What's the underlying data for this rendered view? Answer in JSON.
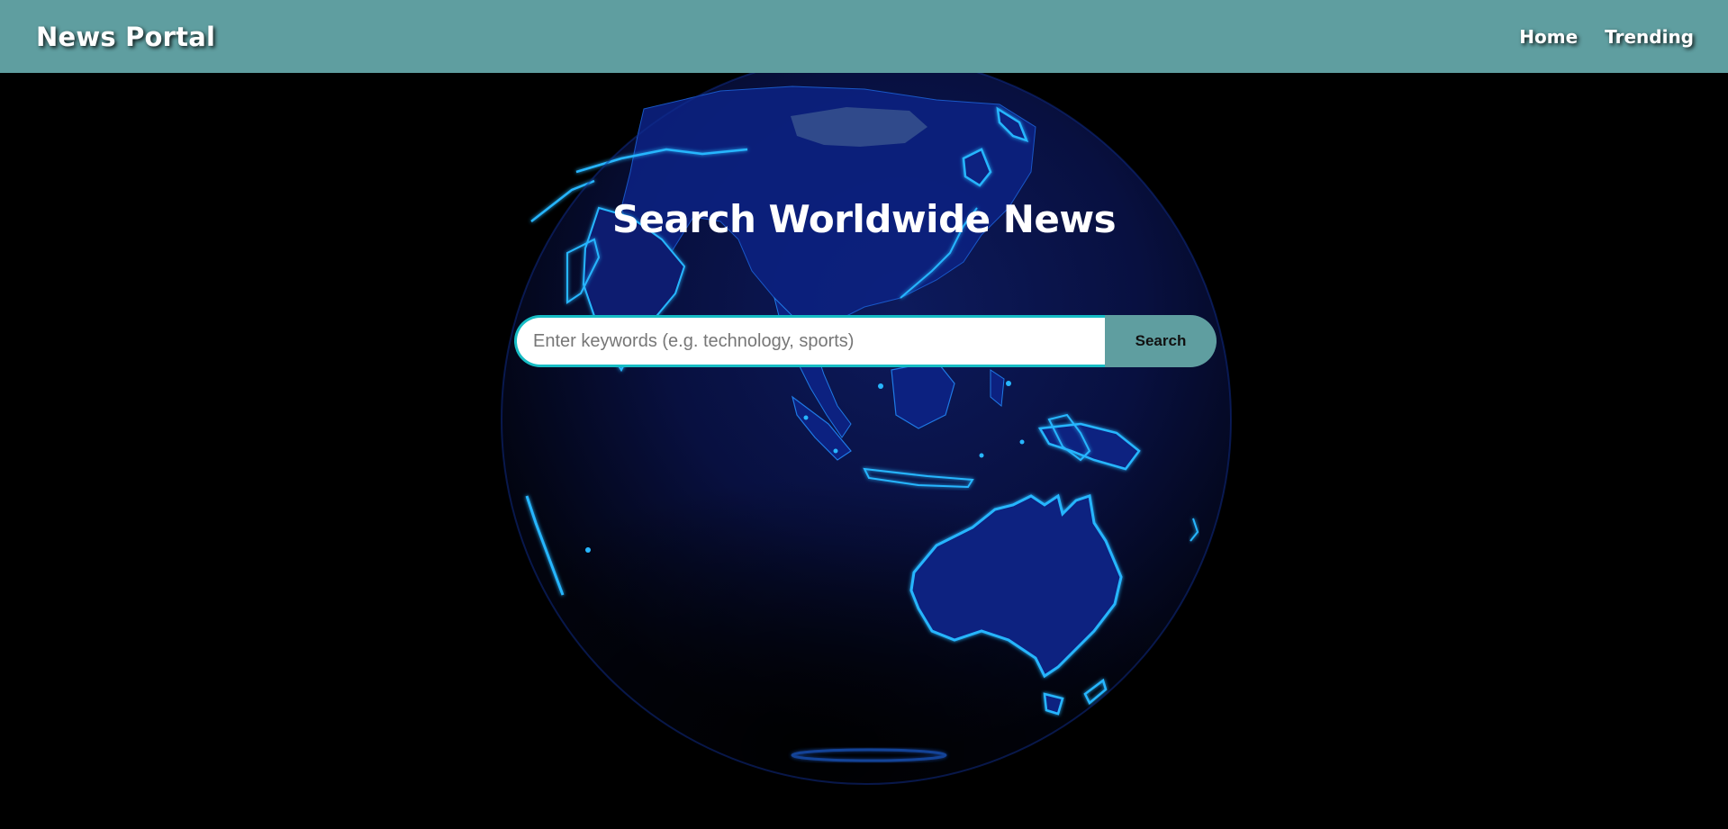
{
  "header": {
    "brand": "News Portal",
    "nav": [
      {
        "label": "Home"
      },
      {
        "label": "Trending"
      }
    ]
  },
  "hero": {
    "title": "Search Worldwide News",
    "background": "globe-earth-image"
  },
  "search": {
    "placeholder": "Enter keywords (e.g. technology, sports)",
    "value": "",
    "button_label": "Search"
  },
  "colors": {
    "navbar": "#5f9ea0",
    "accent_border": "#17bcc4",
    "background": "#000000",
    "globe_ocean": "#0a1240",
    "globe_land": "#0c2180",
    "coastline_glow": "#27b6ff"
  }
}
